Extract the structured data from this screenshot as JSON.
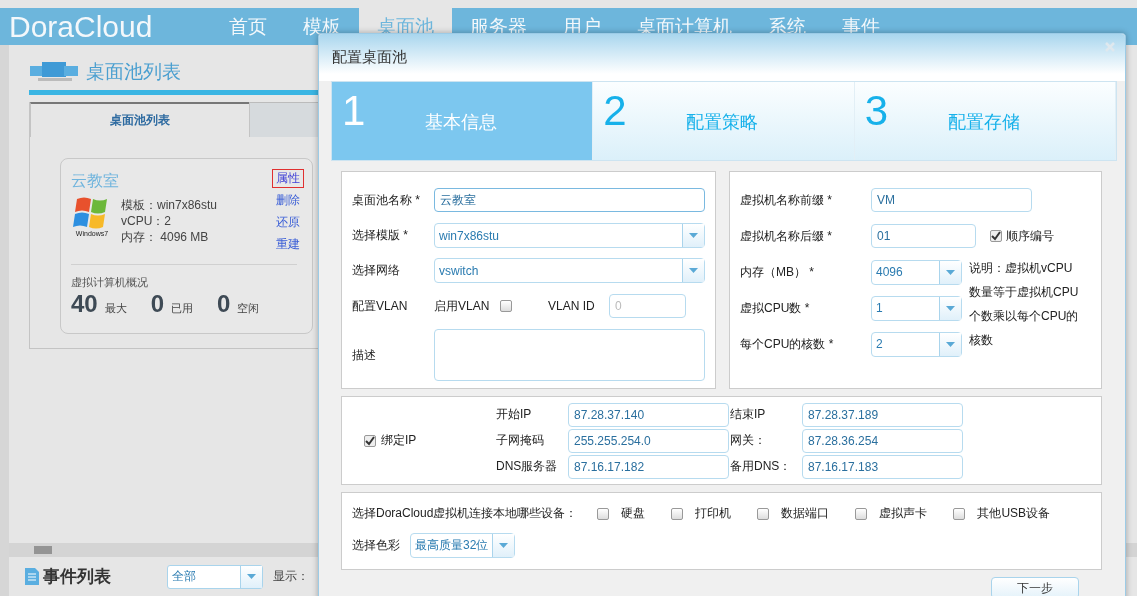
{
  "brand": "DoraCloud",
  "nav": [
    {
      "label": "首页",
      "selected": false
    },
    {
      "label": "模板",
      "selected": false
    },
    {
      "label": "桌面池",
      "selected": true
    },
    {
      "label": "服务器",
      "selected": false
    },
    {
      "label": "用户",
      "selected": false
    },
    {
      "label": "桌面计算机",
      "selected": false
    },
    {
      "label": "系统",
      "selected": false
    },
    {
      "label": "事件",
      "selected": false
    }
  ],
  "page_title": "桌面池列表",
  "tabs": [
    {
      "label": "桌面池列表",
      "selected": true
    },
    {
      "selected": false
    }
  ],
  "pool_card": {
    "name": "云教室",
    "os_caption": "Windows7",
    "specs": [
      "模板：win7x86stu",
      "vCPU：2",
      "内存： 4096 MB"
    ],
    "actions": [
      {
        "label": "属性",
        "highlighted": true
      },
      {
        "label": "删除",
        "highlighted": false
      },
      {
        "label": "还原",
        "highlighted": false
      },
      {
        "label": "重建",
        "highlighted": false
      }
    ],
    "summary_title": "虚拟计算机概况",
    "stats": [
      {
        "value": "40",
        "label": "最大"
      },
      {
        "value": "0",
        "label": "已用"
      },
      {
        "value": "0",
        "label": "空闲"
      }
    ]
  },
  "events": {
    "title": "事件列表",
    "filter": "全部",
    "show_label": "显示："
  },
  "dialog": {
    "title": "配置桌面池",
    "steps": [
      {
        "number": "1",
        "label": "基本信息",
        "selected": true
      },
      {
        "number": "2",
        "label": "配置策略",
        "selected": false
      },
      {
        "number": "3",
        "label": "配置存储",
        "selected": false
      }
    ],
    "basic_fields": [
      {
        "kind": "text",
        "label": "桌面池名称 *",
        "value": "云教室",
        "focused": true
      },
      {
        "kind": "select",
        "label": "选择模版 *",
        "value": "win7x86stu"
      },
      {
        "kind": "select",
        "label": "选择网络",
        "value": "vswitch"
      },
      {
        "kind": "vlan",
        "label": "配置VLAN",
        "toggle_label": "启用VLAN",
        "checked": false,
        "id_label": "VLAN ID",
        "id_value": "0",
        "disabled": true
      },
      {
        "kind": "textarea",
        "label": "描述"
      }
    ],
    "vm_fields": [
      {
        "kind": "text",
        "label": "虚拟机名称前缀 *",
        "value": "VM"
      },
      {
        "kind": "suffix",
        "label": "虚拟机名称后缀 *",
        "value": "01",
        "check_label": "顺序编号",
        "checked": true
      },
      {
        "kind": "select",
        "label": "内存（MB） *",
        "value": "4096"
      },
      {
        "kind": "select",
        "label": "虚拟CPU数 *",
        "value": "1"
      },
      {
        "kind": "select",
        "label": "每个CPU的核数 *",
        "value": "2"
      }
    ],
    "vm_note": "说明：虚拟机vCPU数量等于虚拟机CPU个数乘以每个CPU的核数",
    "bind_ip": {
      "label": "绑定IP",
      "checked": true
    },
    "ip_fields": [
      {
        "label": "开始IP",
        "value": "87.28.37.140"
      },
      {
        "label": "结束IP",
        "value": "87.28.37.189"
      },
      {
        "label": "子网掩码",
        "value": "255.255.254.0"
      },
      {
        "label": "网关：",
        "value": "87.28.36.254"
      },
      {
        "label": "DNS服务器",
        "value": "87.16.17.182"
      },
      {
        "label": "备用DNS：",
        "value": "87.16.17.183"
      }
    ],
    "devices_label": "选择DoraCloud虚拟机连接本地哪些设备：",
    "devices": [
      {
        "label": "硬盘",
        "checked": false
      },
      {
        "label": "打印机",
        "checked": false
      },
      {
        "label": "数据端口",
        "checked": false
      },
      {
        "label": "虚拟声卡",
        "checked": false
      },
      {
        "label": "其他USB设备",
        "checked": false
      }
    ],
    "color_label": "选择色彩",
    "color_value": "最高质量32位",
    "next_button": "下一步"
  }
}
